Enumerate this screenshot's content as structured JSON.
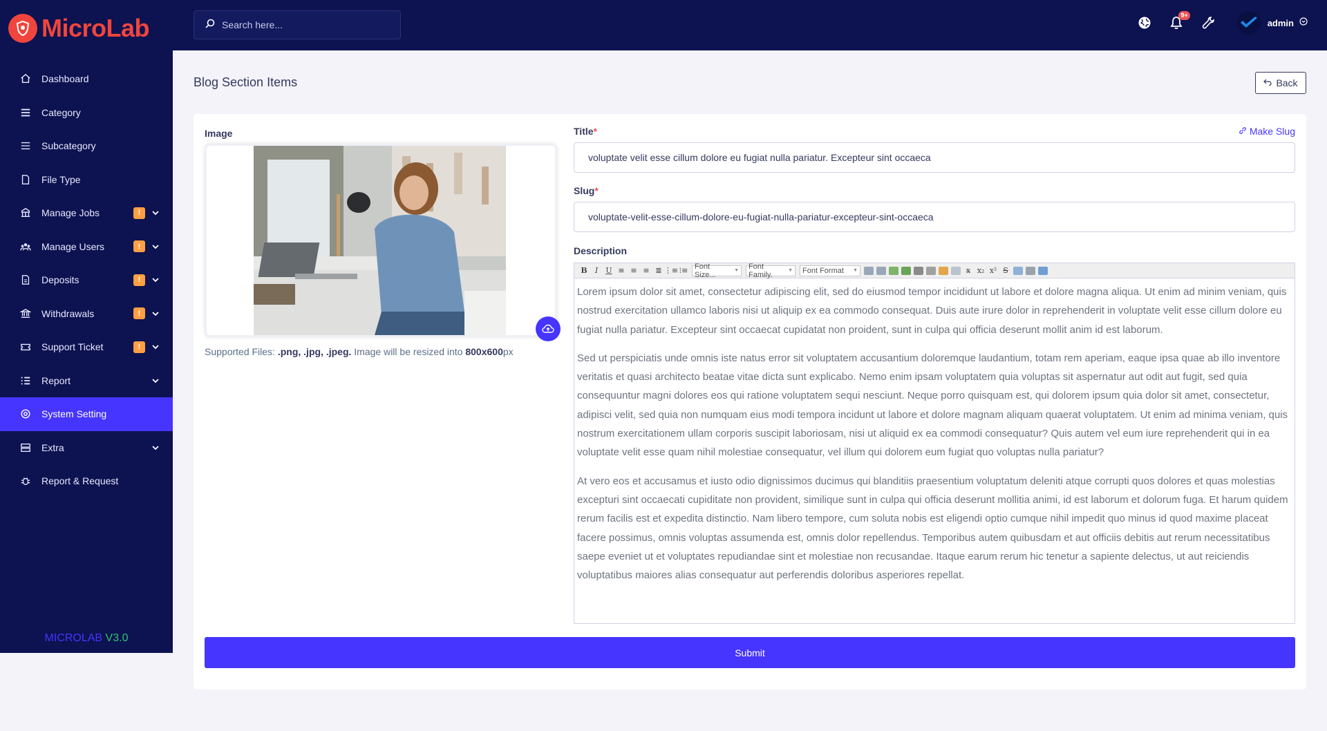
{
  "brand": {
    "name": "MicroLab",
    "version_name": "MICROLAB",
    "version_number": "V3.0"
  },
  "colors": {
    "sidebar_bg": "#0d1250",
    "accent": "#4634ff",
    "badge": "#ff9f43",
    "logo": "#f0453d",
    "version_green": "#28c76f"
  },
  "search": {
    "placeholder": "Search here..."
  },
  "topbar": {
    "notification_count": "9+",
    "user_name": "admin"
  },
  "sidebar": {
    "items": [
      {
        "label": "Dashboard",
        "icon": "home-icon"
      },
      {
        "label": "Category",
        "icon": "menu-icon"
      },
      {
        "label": "Subcategory",
        "icon": "list-icon"
      },
      {
        "label": "File Type",
        "icon": "file-icon"
      },
      {
        "label": "Manage Jobs",
        "icon": "jobs-icon",
        "badge": "!",
        "expandable": true
      },
      {
        "label": "Manage Users",
        "icon": "users-icon",
        "badge": "!",
        "expandable": true
      },
      {
        "label": "Deposits",
        "icon": "deposit-icon",
        "badge": "!",
        "expandable": true
      },
      {
        "label": "Withdrawals",
        "icon": "bank-icon",
        "badge": "!",
        "expandable": true
      },
      {
        "label": "Support Ticket",
        "icon": "ticket-icon",
        "badge": "!",
        "expandable": true
      },
      {
        "label": "Report",
        "icon": "report-icon",
        "expandable": true
      },
      {
        "label": "System Setting",
        "icon": "settings-icon",
        "active": true
      },
      {
        "label": "Extra",
        "icon": "server-icon",
        "expandable": true
      },
      {
        "label": "Report & Request",
        "icon": "bug-icon"
      }
    ]
  },
  "page": {
    "title": "Blog Section Items",
    "back_label": "Back"
  },
  "form": {
    "image_label": "Image",
    "supported_prefix": "Supported Files:",
    "supported_types": ".png, .jpg, .jpeg.",
    "resize_text": "Image will be resized into",
    "resize_size": "800x600",
    "resize_unit": "px",
    "title_label": "Title",
    "make_slug": "Make Slug",
    "title_value": "voluptate velit esse cillum dolore eu fugiat nulla pariatur. Excepteur sint occaeca",
    "slug_label": "Slug",
    "slug_value": "voluptate-velit-esse-cillum-dolore-eu-fugiat-nulla-pariatur-excepteur-sint-occaeca",
    "description_label": "Description",
    "editor": {
      "font_size": "Font Size...",
      "font_family": "Font Family.",
      "font_format": "Font Format",
      "paragraphs": [
        "Lorem ipsum dolor sit amet, consectetur adipiscing elit, sed do eiusmod tempor incididunt ut labore et dolore magna aliqua. Ut enim ad minim veniam, quis nostrud exercitation ullamco laboris nisi ut aliquip ex ea commodo consequat. Duis aute irure dolor in reprehenderit in voluptate velit esse cillum dolore eu fugiat nulla pariatur. Excepteur sint occaecat cupidatat non proident, sunt in culpa qui officia deserunt mollit anim id est laborum.",
        "Sed ut perspiciatis unde omnis iste natus error sit voluptatem accusantium doloremque laudantium, totam rem aperiam, eaque ipsa quae ab illo inventore veritatis et quasi architecto beatae vitae dicta sunt explicabo. Nemo enim ipsam voluptatem quia voluptas sit aspernatur aut odit aut fugit, sed quia consequuntur magni dolores eos qui ratione voluptatem sequi nesciunt. Neque porro quisquam est, qui dolorem ipsum quia dolor sit amet, consectetur, adipisci velit, sed quia non numquam eius modi tempora incidunt ut labore et dolore magnam aliquam quaerat voluptatem. Ut enim ad minima veniam, quis nostrum exercitationem ullam corporis suscipit laboriosam, nisi ut aliquid ex ea commodi consequatur? Quis autem vel eum iure reprehenderit qui in ea voluptate velit esse quam nihil molestiae consequatur, vel illum qui dolorem eum fugiat quo voluptas nulla pariatur?",
        "At vero eos et accusamus et iusto odio dignissimos ducimus qui blanditiis praesentium voluptatum deleniti atque corrupti quos dolores et quas molestias excepturi sint occaecati cupiditate non provident, similique sunt in culpa qui officia deserunt mollitia animi, id est laborum et dolorum fuga. Et harum quidem rerum facilis est et expedita distinctio. Nam libero tempore, cum soluta nobis est eligendi optio cumque nihil impedit quo minus id quod maxime placeat facere possimus, omnis voluptas assumenda est, omnis dolor repellendus. Temporibus autem quibusdam et aut officiis debitis aut rerum necessitatibus saepe eveniet ut et voluptates repudiandae sint et molestiae non recusandae. Itaque earum rerum hic tenetur a sapiente delectus, ut aut reiciendis voluptatibus maiores alias consequatur aut perferendis doloribus asperiores repellat."
      ]
    },
    "submit_label": "Submit"
  }
}
